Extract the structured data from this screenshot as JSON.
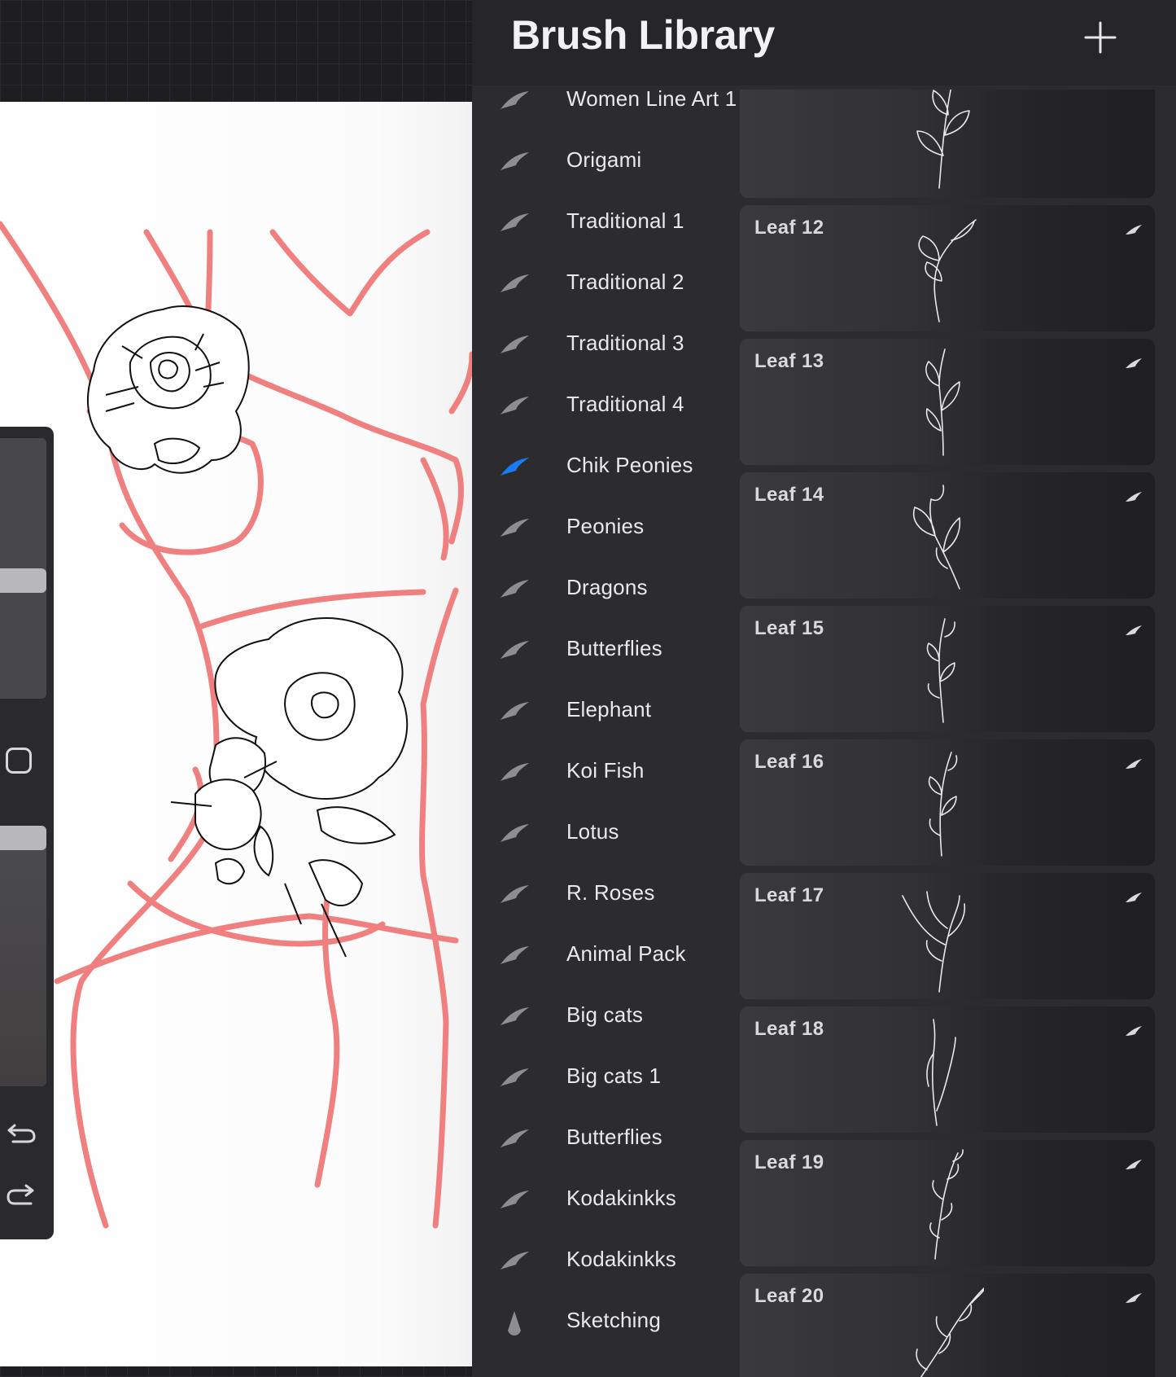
{
  "panel": {
    "title": "Brush Library",
    "add_button": "+"
  },
  "brush_sets": [
    {
      "label": "Women Line Art 1",
      "icon": "brush-stroke-icon",
      "selected": false
    },
    {
      "label": "Origami",
      "icon": "brush-stroke-icon",
      "selected": false
    },
    {
      "label": "Traditional 1",
      "icon": "brush-stroke-icon",
      "selected": false
    },
    {
      "label": "Traditional 2",
      "icon": "brush-stroke-icon",
      "selected": false
    },
    {
      "label": "Traditional 3",
      "icon": "brush-stroke-icon",
      "selected": false
    },
    {
      "label": "Traditional 4",
      "icon": "brush-stroke-icon",
      "selected": false
    },
    {
      "label": "Chik Peonies",
      "icon": "brush-stroke-icon",
      "selected": true
    },
    {
      "label": "Peonies",
      "icon": "brush-stroke-icon",
      "selected": false
    },
    {
      "label": "Dragons",
      "icon": "brush-stroke-icon",
      "selected": false
    },
    {
      "label": "Butterflies",
      "icon": "brush-stroke-icon",
      "selected": false
    },
    {
      "label": "Elephant",
      "icon": "brush-stroke-icon",
      "selected": false
    },
    {
      "label": "Koi Fish",
      "icon": "brush-stroke-icon",
      "selected": false
    },
    {
      "label": "Lotus",
      "icon": "brush-stroke-icon",
      "selected": false
    },
    {
      "label": "R. Roses",
      "icon": "brush-stroke-icon",
      "selected": false
    },
    {
      "label": "Animal Pack",
      "icon": "brush-stroke-icon",
      "selected": false
    },
    {
      "label": "Big cats",
      "icon": "brush-stroke-icon",
      "selected": false
    },
    {
      "label": "Big cats 1",
      "icon": "brush-stroke-icon",
      "selected": false
    },
    {
      "label": "Butterflies",
      "icon": "brush-stroke-icon",
      "selected": false
    },
    {
      "label": "Kodakinkks",
      "icon": "brush-stroke-icon",
      "selected": false
    },
    {
      "label": "Kodakinkks",
      "icon": "brush-stroke-icon",
      "selected": false
    },
    {
      "label": "Sketching",
      "icon": "pencil-tip-icon",
      "selected": false
    }
  ],
  "brushes": [
    {
      "name": ""
    },
    {
      "name": "Leaf 12"
    },
    {
      "name": "Leaf 13"
    },
    {
      "name": "Leaf 14"
    },
    {
      "name": "Leaf 15"
    },
    {
      "name": "Leaf 16"
    },
    {
      "name": "Leaf 17"
    },
    {
      "name": "Leaf 18"
    },
    {
      "name": "Leaf 19"
    },
    {
      "name": "Leaf 20"
    }
  ],
  "colors": {
    "selected_accent": "#1a7cf5",
    "sketch_lines": "#f07f7f",
    "panel_background": "#2c2c2e"
  }
}
